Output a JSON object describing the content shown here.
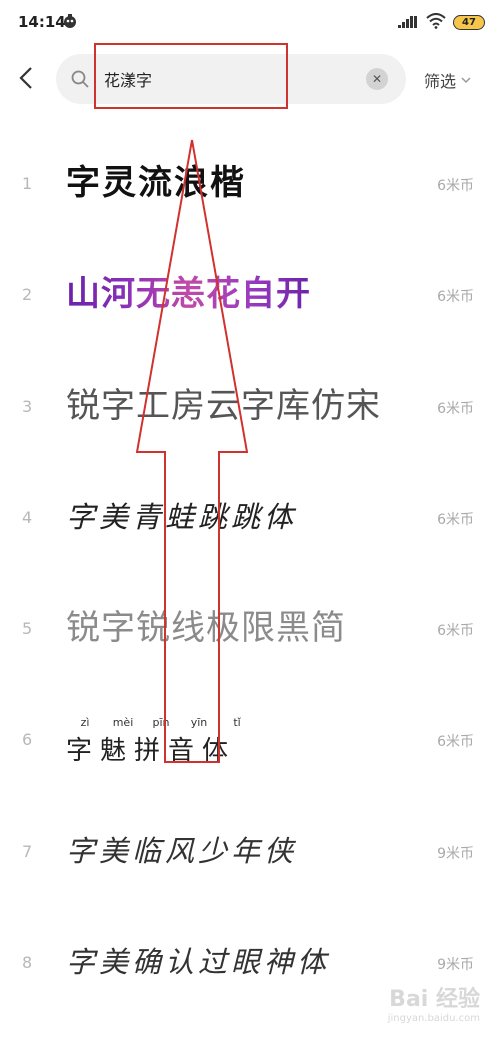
{
  "status_bar": {
    "time": "14:14",
    "battery": "47"
  },
  "search": {
    "query": "花漾字",
    "clear_icon": "close-icon"
  },
  "filter": {
    "label": "筛选"
  },
  "results": [
    {
      "index": "1",
      "name": "字灵流浪楷",
      "price": "6米币"
    },
    {
      "index": "2",
      "name": "山河无恙花自开",
      "price": "6米币"
    },
    {
      "index": "3",
      "name": "锐字工房云字库仿宋",
      "price": "6米币"
    },
    {
      "index": "4",
      "name": "字美青蛙跳跳体",
      "price": "6米币"
    },
    {
      "index": "5",
      "name": "锐字锐线极限黑简",
      "price": "6米币"
    },
    {
      "index": "6",
      "name": "字魅拼音体",
      "pinyin": [
        "zì",
        "mèi",
        "pīn",
        "yīn",
        "tǐ"
      ],
      "price": "6米币"
    },
    {
      "index": "7",
      "name": "字美临风少年侠",
      "price": "9米币"
    },
    {
      "index": "8",
      "name": "字美确认过眼神体",
      "price": "9米币"
    }
  ],
  "watermark": {
    "main": "Bai 经验",
    "sub": "jingyan.baidu.com"
  },
  "colors": {
    "annotation": "#d0322f",
    "price": "#a9a9a9",
    "search_bg": "#f1f1f1"
  }
}
